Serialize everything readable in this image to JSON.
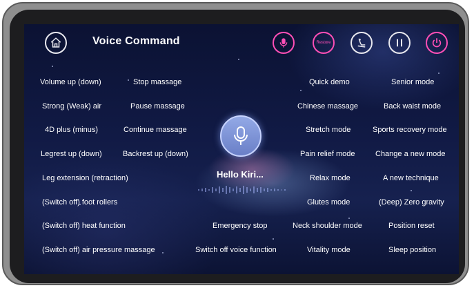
{
  "header": {
    "title": "Voice Command"
  },
  "top_buttons": {
    "restore_label": "Restore"
  },
  "commands": {
    "col1": [
      "Volume up (down)",
      "Strong (Weak) air",
      "4D plus (minus)",
      "Legrest up (down)",
      "Leg extension (retraction)",
      "(Switch off) foot rollers",
      "(Switch off) heat function",
      "(Switch off) air pressure massage"
    ],
    "col2": [
      "Stop massage",
      "Pause massage",
      "Continue massage",
      "Backrest up (down)"
    ],
    "col_mid": [
      "Emergency stop",
      "Switch off voice function"
    ],
    "col3": [
      "Quick demo",
      "Chinese massage",
      "Stretch mode",
      "Pain relief mode",
      "Relax mode",
      "Glutes mode",
      "Neck shoulder mode",
      "Vitality mode"
    ],
    "col4": [
      "Senior mode",
      "Back waist mode",
      "Sports recovery mode",
      "Change a new mode",
      "A new technique",
      "(Deep) Zero gravity",
      "Position reset",
      "Sleep position"
    ]
  },
  "assistant": {
    "greeting": "Hello Kiri..."
  },
  "colors": {
    "accent": "#ff4fb6",
    "text": "#ffffff",
    "mic": "#8aa0e0"
  }
}
